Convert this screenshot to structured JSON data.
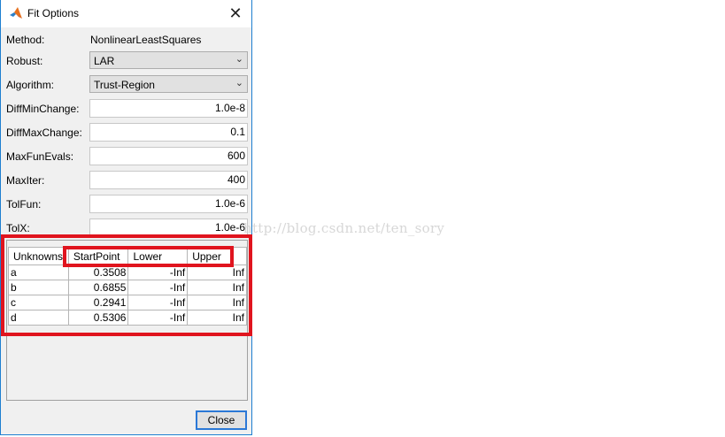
{
  "window": {
    "title": "Fit Options",
    "close_glyph": "✕"
  },
  "method": {
    "label": "Method:",
    "value": "NonlinearLeastSquares"
  },
  "robust": {
    "label": "Robust:",
    "value": "LAR"
  },
  "algorithm": {
    "label": "Algorithm:",
    "value": "Trust-Region"
  },
  "fields": [
    {
      "label": "DiffMinChange:",
      "value": "1.0e-8"
    },
    {
      "label": "DiffMaxChange:",
      "value": "0.1"
    },
    {
      "label": "MaxFunEvals:",
      "value": "600"
    },
    {
      "label": "MaxIter:",
      "value": "400"
    },
    {
      "label": "TolFun:",
      "value": "1.0e-6"
    },
    {
      "label": "TolX:",
      "value": "1.0e-6"
    }
  ],
  "table": {
    "headers": [
      "Unknowns",
      "StartPoint",
      "Lower",
      "Upper"
    ],
    "rows": [
      [
        "a",
        "0.3508",
        "-Inf",
        "Inf"
      ],
      [
        "b",
        "0.6855",
        "-Inf",
        "Inf"
      ],
      [
        "c",
        "0.2941",
        "-Inf",
        "Inf"
      ],
      [
        "d",
        "0.5306",
        "-Inf",
        "Inf"
      ]
    ]
  },
  "close_button": "Close",
  "watermark": "http://blog.csdn.net/ten_sory",
  "colors": {
    "highlight": "#e0141e",
    "accent": "#2b78d6"
  },
  "icons": {
    "app": "matlab-logo-icon",
    "dropdown": "chevron-down-icon"
  }
}
